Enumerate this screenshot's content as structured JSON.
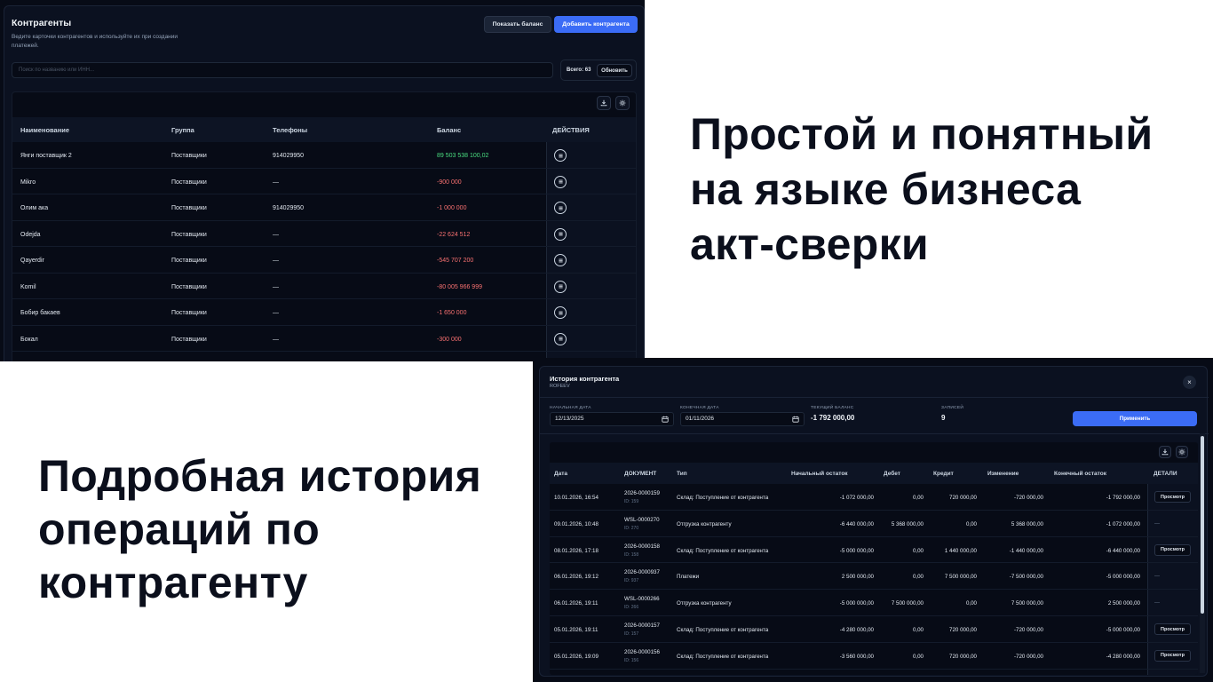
{
  "headlines": {
    "top_right": [
      "Простой и понятный",
      "на языке бизнеса",
      "акт-сверки"
    ],
    "bottom_left": [
      "Подробная история",
      "операций по",
      "контрагенту"
    ]
  },
  "counterparties": {
    "title": "Контрагенты",
    "subtitle": "Ведите карточки контрагентов и используйте их при создании платежей.",
    "show_balance_label": "Показать баланс",
    "add_label": "Добавить контрагента",
    "search_placeholder": "Поиск по названию или ИНН...",
    "total_label": "Всего: 63",
    "refresh_label": "Обновить",
    "icons": [
      "download-icon",
      "gear-icon",
      "menu-icon"
    ],
    "columns": [
      "Наименование",
      "Группа",
      "Телефоны",
      "Баланс",
      "ДЕЙСТВИЯ"
    ],
    "rows": [
      {
        "name": "Янги поставщик 2",
        "group": "Поставщики",
        "phone": "914029950",
        "balance": "89 503 538 100,02",
        "sign": "pos"
      },
      {
        "name": "Mikro",
        "group": "Поставщики",
        "phone": "—",
        "balance": "-900 000",
        "sign": "neg"
      },
      {
        "name": "Олим ака",
        "group": "Поставщики",
        "phone": "914029950",
        "balance": "-1 000 000",
        "sign": "neg"
      },
      {
        "name": "Odejda",
        "group": "Поставщики",
        "phone": "—",
        "balance": "-22 624 512",
        "sign": "neg"
      },
      {
        "name": "Qayerdir",
        "group": "Поставщики",
        "phone": "—",
        "balance": "-545 707 200",
        "sign": "neg"
      },
      {
        "name": "Komil",
        "group": "Поставщики",
        "phone": "—",
        "balance": "-80 005 966 999",
        "sign": "neg"
      },
      {
        "name": "Бобир бакаев",
        "group": "Поставщики",
        "phone": "—",
        "balance": "-1 650 000",
        "sign": "neg"
      },
      {
        "name": "Бокал",
        "group": "Поставщики",
        "phone": "—",
        "balance": "-300 000",
        "sign": "neg"
      }
    ],
    "colors": {
      "positive": "#4ade80",
      "negative": "#f87171",
      "accent": "#3b6cf6"
    }
  },
  "history": {
    "title": "История контрагента",
    "subtitle": "ROFEEV",
    "close_glyph": "×",
    "start_date_label": "НАЧАЛЬНАЯ ДАТА",
    "start_date": "12/13/2025",
    "end_date_label": "КОНЕЧНАЯ ДАТА",
    "end_date": "01/11/2026",
    "balance_label": "ТЕКУЩИЙ БАЛАНС",
    "balance_value": "-1 792 000,00",
    "records_label": "ЗАПИСЕЙ",
    "records_value": "9",
    "apply_label": "Применить",
    "columns": [
      "Дата",
      "ДОКУМЕНТ",
      "Тип",
      "Начальный остаток",
      "Дебет",
      "Кредит",
      "Изменение",
      "Конечный остаток",
      "ДЕТАЛИ"
    ],
    "view_label": "Просмотр",
    "rows": [
      {
        "date": "10.01.2026, 16:54",
        "doc": "2026-0000159",
        "doc_id": "ID: 159",
        "type": "Склад: Поступление от контрагента",
        "start": "-1 072 000,00",
        "debit": "0,00",
        "credit": "720 000,00",
        "change": "-720 000,00",
        "sign": "neg",
        "end": "-1 792 000,00",
        "details": "view"
      },
      {
        "date": "09.01.2026, 10:48",
        "doc": "WSL-0000270",
        "doc_id": "ID: 270",
        "type": "Отгрузка контрагенту",
        "start": "-6 440 000,00",
        "debit": "5 368 000,00",
        "credit": "0,00",
        "change": "5 368 000,00",
        "sign": "pos",
        "end": "-1 072 000,00",
        "details": "—"
      },
      {
        "date": "08.01.2026, 17:18",
        "doc": "2026-0000158",
        "doc_id": "ID: 158",
        "type": "Склад: Поступление от контрагента",
        "start": "-5 000 000,00",
        "debit": "0,00",
        "credit": "1 440 000,00",
        "change": "-1 440 000,00",
        "sign": "neg",
        "end": "-6 440 000,00",
        "details": "view"
      },
      {
        "date": "06.01.2026, 19:12",
        "doc": "2026-0000937",
        "doc_id": "ID: 937",
        "type": "Платежи",
        "start": "2 500 000,00",
        "debit": "0,00",
        "credit": "7 500 000,00",
        "change": "-7 500 000,00",
        "sign": "neg",
        "end": "-5 000 000,00",
        "details": "—"
      },
      {
        "date": "06.01.2026, 19:11",
        "doc": "WSL-0000266",
        "doc_id": "ID: 266",
        "type": "Отгрузка контрагенту",
        "start": "-5 000 000,00",
        "debit": "7 500 000,00",
        "credit": "0,00",
        "change": "7 500 000,00",
        "sign": "pos",
        "end": "2 500 000,00",
        "details": "—"
      },
      {
        "date": "05.01.2026, 19:11",
        "doc": "2026-0000157",
        "doc_id": "ID: 157",
        "type": "Склад: Поступление от контрагента",
        "start": "-4 280 000,00",
        "debit": "0,00",
        "credit": "720 000,00",
        "change": "-720 000,00",
        "sign": "neg",
        "end": "-5 000 000,00",
        "details": "view"
      },
      {
        "date": "05.01.2026, 19:09",
        "doc": "2026-0000156",
        "doc_id": "ID: 156",
        "type": "Склад: Поступление от контрагента",
        "start": "-3 560 000,00",
        "debit": "0,00",
        "credit": "720 000,00",
        "change": "-720 000,00",
        "sign": "neg",
        "end": "-4 280 000,00",
        "details": "view"
      }
    ]
  }
}
